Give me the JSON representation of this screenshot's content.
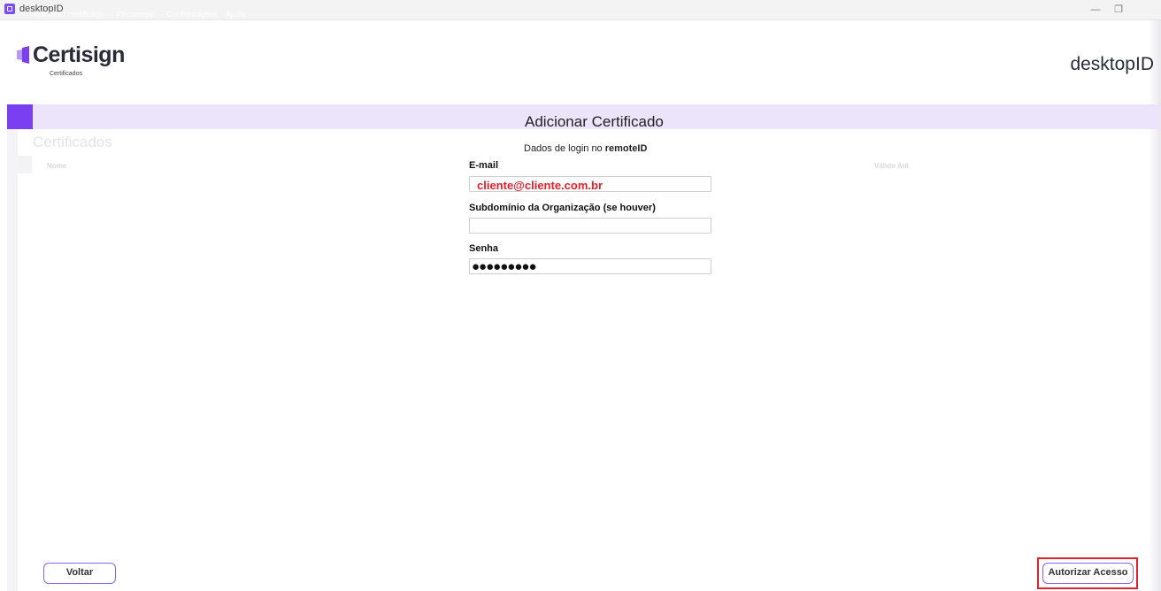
{
  "window": {
    "title": "desktopID",
    "minimize_glyph": "—",
    "restore_glyph": "❐"
  },
  "header": {
    "logo_name": "Certisign",
    "logo_sub": "Certificados",
    "app_name": "desktopID",
    "brand_color": "#7a3ff0"
  },
  "menu": {
    "items": [
      "Adicionar certificado",
      "Recarregar",
      "Configurações",
      "Ajuda"
    ]
  },
  "background": {
    "heading": "Certificados",
    "columns": [
      "Nome",
      "Válido Até"
    ]
  },
  "dialog": {
    "title": "Adicionar Certificado",
    "subtitle_prefix": "Dados de login no ",
    "subtitle_service": "remoteID",
    "email_label": "E-mail",
    "email_value": "cliente@cliente.com.br",
    "subdomain_label": "Subdomínio da Organização (se houver)",
    "subdomain_value": "",
    "password_label": "Senha",
    "password_mask": "●●●●●●●●●"
  },
  "buttons": {
    "back": "Voltar",
    "authorize": "Autorizar Acesso"
  }
}
